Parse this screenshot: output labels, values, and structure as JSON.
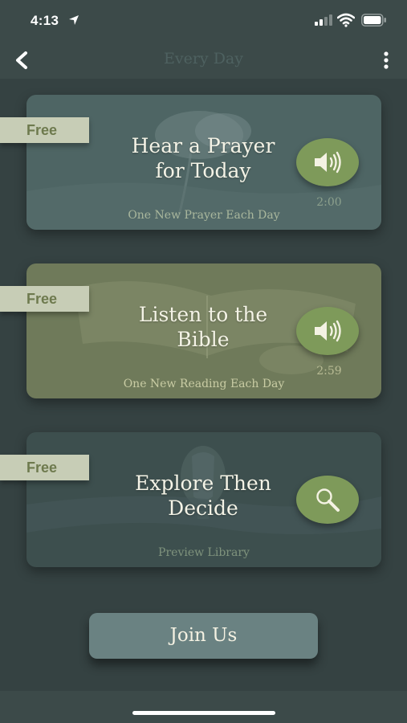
{
  "status_bar": {
    "time": "4:13",
    "icons": [
      "location-arrow-icon",
      "cellular-signal-icon",
      "wifi-icon",
      "battery-icon"
    ]
  },
  "nav": {
    "title": "Every Day",
    "icons": [
      "chevron-left-icon",
      "more-vertical-icon"
    ]
  },
  "cards": [
    {
      "tag": "Free",
      "title_line1": "Hear a Prayer",
      "title_line2": "for Today",
      "subtitle": "One New Prayer Each Day",
      "duration": "2:00",
      "action_icon": "speaker-icon"
    },
    {
      "tag": "Free",
      "title_line1": "Listen to the",
      "title_line2": "Bible",
      "subtitle": "One New Reading Each Day",
      "duration": "2:59",
      "action_icon": "speaker-icon"
    },
    {
      "tag": "Free",
      "title_line1": "Explore Then",
      "title_line2": "Decide",
      "subtitle": "Preview Library",
      "action_icon": "magnifier-icon"
    }
  ],
  "join_button": {
    "label": "Join Us"
  },
  "colors": {
    "background": "#354242",
    "accent_green": "#7e9a5a",
    "tag_bg": "#c7cdb6",
    "join_button": "#6a8282"
  }
}
